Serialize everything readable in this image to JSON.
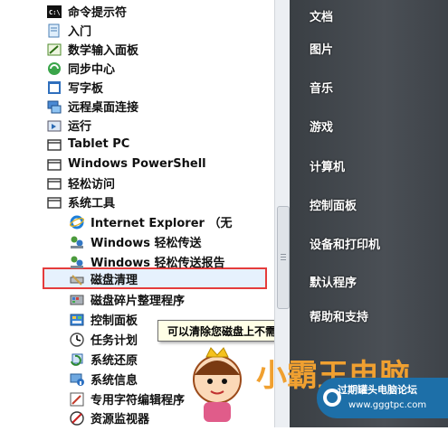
{
  "menu": {
    "items": [
      {
        "label": "命令提示符",
        "icon": "cmd-icon"
      },
      {
        "label": "入门",
        "icon": "getting-started-icon"
      },
      {
        "label": "数学输入面板",
        "icon": "math-input-icon"
      },
      {
        "label": "同步中心",
        "icon": "sync-icon"
      },
      {
        "label": "写字板",
        "icon": "wordpad-icon"
      },
      {
        "label": "远程桌面连接",
        "icon": "remote-desktop-icon"
      },
      {
        "label": "运行",
        "icon": "run-icon"
      },
      {
        "label": "Tablet PC",
        "icon": "folder-icon"
      },
      {
        "label": "Windows PowerShell",
        "icon": "folder-icon"
      },
      {
        "label": "轻松访问",
        "icon": "folder-icon"
      },
      {
        "label": "系统工具",
        "icon": "folder-icon"
      },
      {
        "label": "Internet Explorer （无",
        "icon": "ie-icon"
      },
      {
        "label": "Windows 轻松传送",
        "icon": "easy-transfer-icon"
      },
      {
        "label": "Windows 轻松传送报告",
        "icon": "easy-transfer-icon"
      },
      {
        "label": "磁盘清理",
        "icon": "disk-cleanup-icon"
      },
      {
        "label": "磁盘碎片整理程序",
        "icon": "defrag-icon"
      },
      {
        "label": "控制面板",
        "icon": "control-panel-icon"
      },
      {
        "label": "任务计划",
        "icon": "task-scheduler-icon"
      },
      {
        "label": "系统还原",
        "icon": "system-restore-icon"
      },
      {
        "label": "系统信息",
        "icon": "system-info-icon"
      },
      {
        "label": "专用字符编辑程序",
        "icon": "char-editor-icon"
      },
      {
        "label": "资源监视器",
        "icon": "resource-monitor-icon"
      }
    ],
    "selected": "磁盘清理"
  },
  "right_panel": {
    "items": [
      "文档",
      "图片",
      "音乐",
      "游戏",
      "计算机",
      "控制面板",
      "设备和打印机",
      "默认程序",
      "帮助和支持"
    ]
  },
  "tooltip": {
    "text": "可以清除您磁盘上不需要的文件。"
  },
  "watermark": {
    "title": "小霸王电脑",
    "badge_line1": "过期罐头电脑论坛",
    "badge_line2": "www.gggtpc.com"
  },
  "colors": {
    "highlight_border": "#e53c3c",
    "right_panel_bg": "#444a50",
    "tooltip_bg": "#ffffe6"
  }
}
